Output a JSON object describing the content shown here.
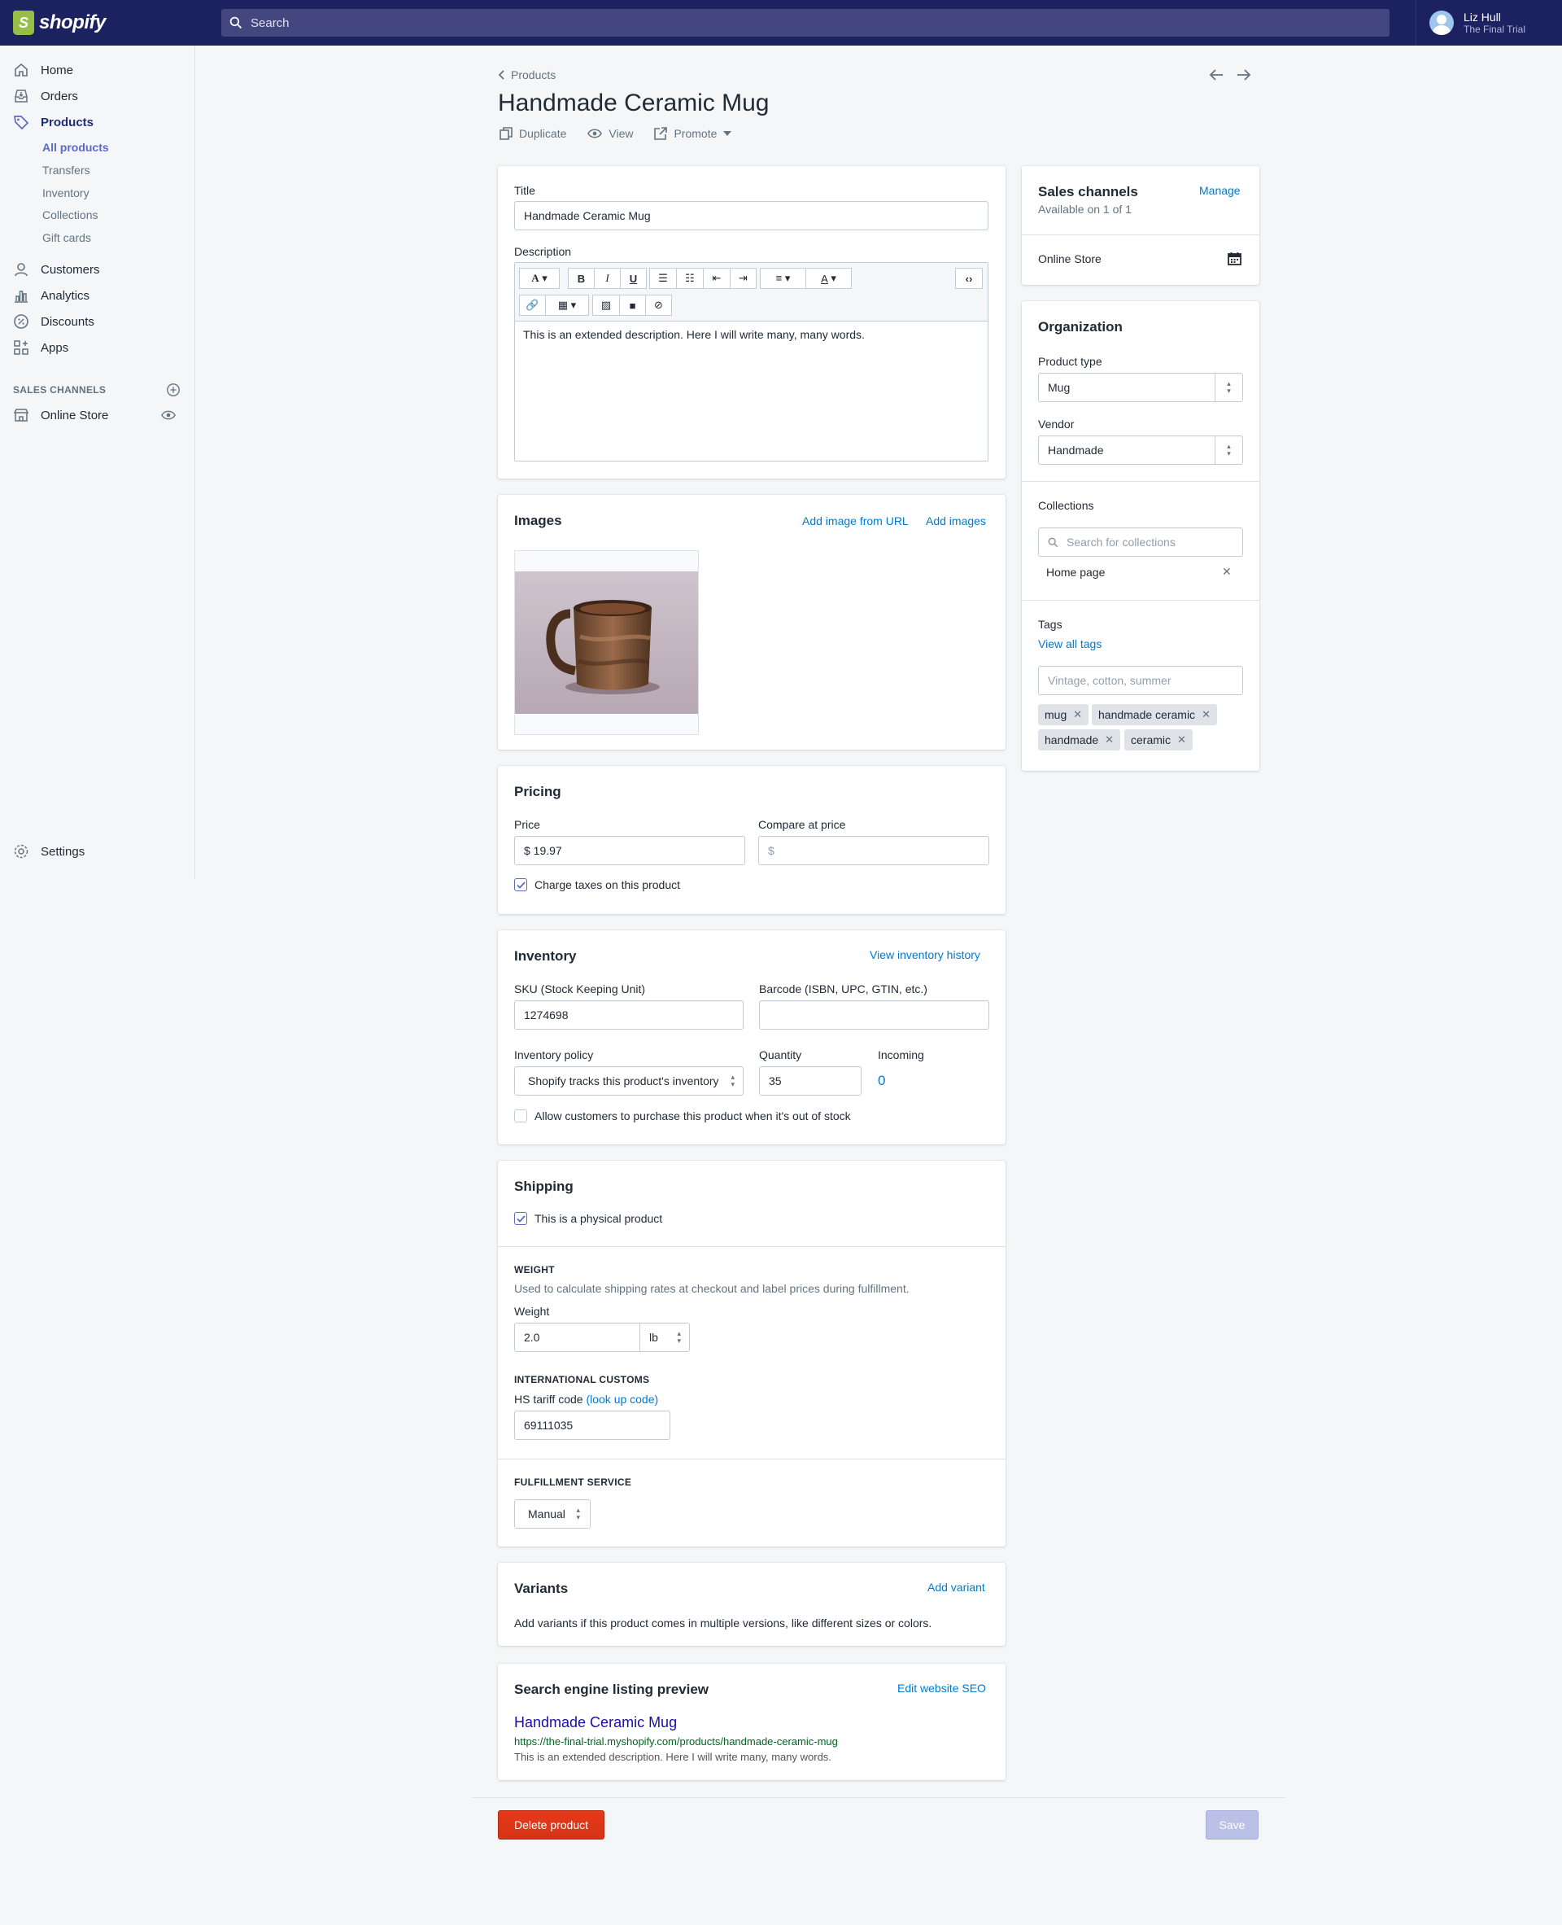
{
  "brand": {
    "name": "shopify",
    "accent": "#1c2260",
    "logo_green": "#95bf47"
  },
  "search": {
    "placeholder": "Search"
  },
  "user": {
    "name": "Liz Hull",
    "shop": "The Final Trial"
  },
  "sidebar": {
    "items": [
      {
        "label": "Home",
        "icon": "home-icon"
      },
      {
        "label": "Orders",
        "icon": "orders-icon"
      },
      {
        "label": "Products",
        "icon": "tag-icon"
      },
      {
        "label": "Customers",
        "icon": "person-icon"
      },
      {
        "label": "Analytics",
        "icon": "bar-chart-icon"
      },
      {
        "label": "Discounts",
        "icon": "discount-icon"
      },
      {
        "label": "Apps",
        "icon": "apps-icon"
      }
    ],
    "product_sub": [
      "All products",
      "Transfers",
      "Inventory",
      "Collections",
      "Gift cards"
    ],
    "sales_channels_heading": "SALES CHANNELS",
    "online_store": "Online Store",
    "settings": "Settings"
  },
  "header": {
    "breadcrumb": "Products",
    "title": "Handmade Ceramic Mug",
    "actions": {
      "duplicate": "Duplicate",
      "view": "View",
      "promote": "Promote"
    }
  },
  "details": {
    "title_label": "Title",
    "title_value": "Handmade Ceramic Mug",
    "description_label": "Description",
    "description_text": "This is an extended description. Here I will write many, many words."
  },
  "images": {
    "heading": "Images",
    "add_url": "Add image from URL",
    "add_images": "Add images"
  },
  "pricing": {
    "heading": "Pricing",
    "price_label": "Price",
    "price_value": "$ 19.97",
    "compare_label": "Compare at price",
    "compare_placeholder": "$",
    "charge_taxes": "Charge taxes on this product"
  },
  "inventory": {
    "heading": "Inventory",
    "history_link": "View inventory history",
    "sku_label": "SKU (Stock Keeping Unit)",
    "sku_value": "1274698",
    "barcode_label": "Barcode (ISBN, UPC, GTIN, etc.)",
    "policy_label": "Inventory policy",
    "policy_value": "Shopify tracks this product's inventory",
    "quantity_label": "Quantity",
    "quantity_value": "35",
    "incoming_label": "Incoming",
    "incoming_value": "0",
    "allow_oos": "Allow customers to purchase this product when it's out of stock"
  },
  "shipping": {
    "heading": "Shipping",
    "physical": "This is a physical product",
    "weight_caps": "WEIGHT",
    "weight_help": "Used to calculate shipping rates at checkout and label prices during fulfillment.",
    "weight_label": "Weight",
    "weight_value": "2.0",
    "weight_unit": "lb",
    "customs_caps": "INTERNATIONAL CUSTOMS",
    "hs_label": "HS tariff code",
    "hs_link": "(look up code)",
    "hs_value": "69111035",
    "fulfillment_caps": "FULFILLMENT SERVICE",
    "fulfillment_value": "Manual"
  },
  "variants": {
    "heading": "Variants",
    "add": "Add variant",
    "help": "Add variants if this product comes in multiple versions, like different sizes or colors."
  },
  "seo": {
    "heading": "Search engine listing preview",
    "edit": "Edit website SEO",
    "title": "Handmade Ceramic Mug",
    "url": "https://the-final-trial.myshopify.com/products/handmade-ceramic-mug",
    "description": "This is an extended description. Here I will write many, many words."
  },
  "sales_channels": {
    "heading": "Sales channels",
    "manage": "Manage",
    "available": "Available on 1 of 1",
    "online_store": "Online Store"
  },
  "organization": {
    "heading": "Organization",
    "type_label": "Product type",
    "type_value": "Mug",
    "vendor_label": "Vendor",
    "vendor_value": "Handmade",
    "collections_label": "Collections",
    "collections_placeholder": "Search for collections",
    "collection_item": "Home page",
    "tags_label": "Tags",
    "view_all_tags": "View all tags",
    "tags_placeholder": "Vintage, cotton, summer",
    "tags": [
      "mug",
      "handmade ceramic",
      "handmade",
      "ceramic"
    ]
  },
  "footer": {
    "delete": "Delete product",
    "save": "Save"
  }
}
